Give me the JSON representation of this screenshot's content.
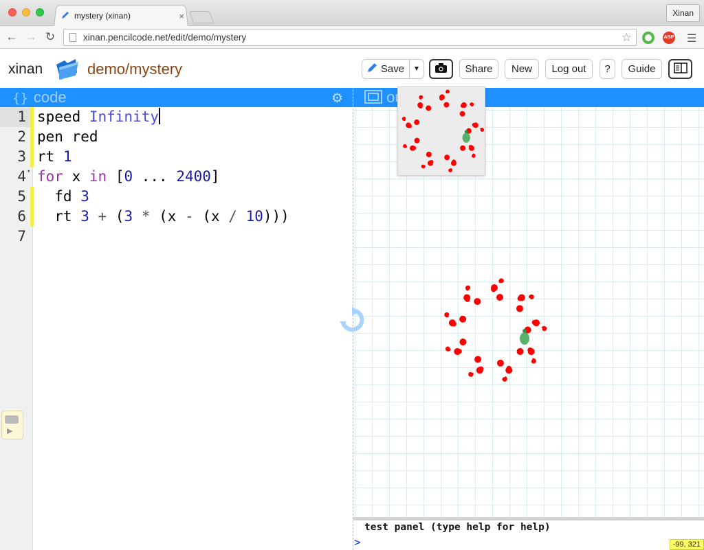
{
  "browser": {
    "tab_title": "mystery (xinan)",
    "tab_close": "×",
    "profile_name": "Xinan",
    "url": "xinan.pencilcode.net/edit/demo/mystery",
    "extension_abp": "ABP"
  },
  "header": {
    "username": "xinan",
    "project_path": "demo/mystery",
    "buttons": {
      "save": "Save",
      "share": "Share",
      "new": "New",
      "logout": "Log out",
      "help": "?",
      "guide": "Guide"
    }
  },
  "code_pane": {
    "title": "code",
    "lines": [
      {
        "n": "1",
        "text": "speed Infinity"
      },
      {
        "n": "2",
        "text": "pen red"
      },
      {
        "n": "3",
        "text": "rt 1"
      },
      {
        "n": "4",
        "text": "for x in [0 ... 2400]"
      },
      {
        "n": "5",
        "text": "  fd 3"
      },
      {
        "n": "6",
        "text": "  rt 3 + (3 * (x - (x / 10)))"
      },
      {
        "n": "7",
        "text": ""
      }
    ]
  },
  "output_pane": {
    "title": "output",
    "test_panel_label": "test panel (type help for help)",
    "prompt": ">",
    "coords": "-99, 321"
  },
  "icons": {
    "pencil": "pencil-icon",
    "camera": "camera-icon",
    "gear": "gear-icon",
    "folder": "folder-icon",
    "run": "run-icon",
    "turtle": "turtle-icon",
    "layout": "layout-toggle-icon"
  },
  "colors": {
    "pane_title_bar": "#1e90ff",
    "drawing_pen": "#ff0000",
    "project_path": "#8b4513",
    "coords_badge": "#ffff66"
  }
}
